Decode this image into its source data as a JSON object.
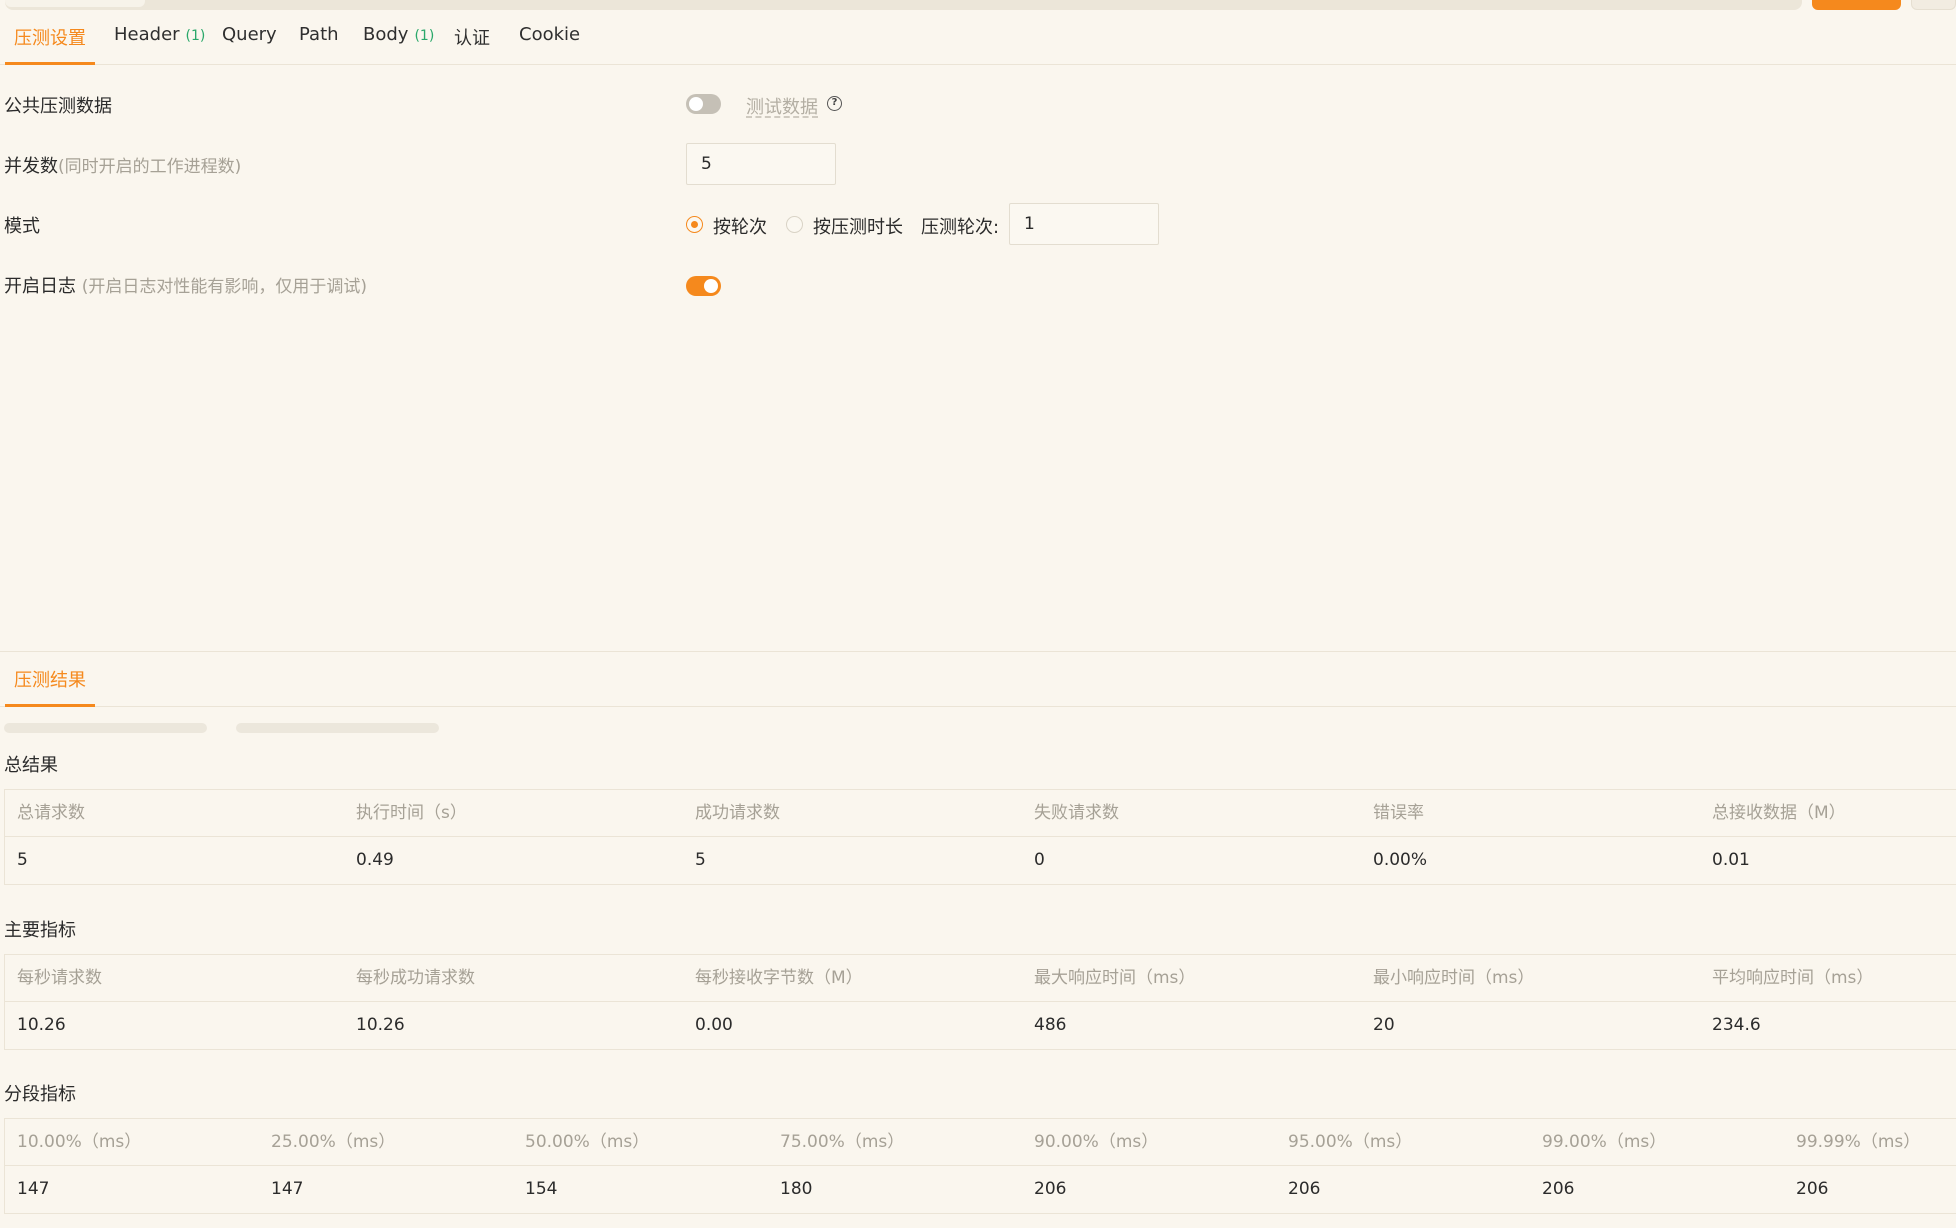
{
  "tabs": [
    {
      "label": "压测设置",
      "count": ""
    },
    {
      "label": "Header",
      "count": "(1)"
    },
    {
      "label": "Query",
      "count": ""
    },
    {
      "label": "Path",
      "count": ""
    },
    {
      "label": "Body",
      "count": "(1)"
    },
    {
      "label": "认证",
      "count": ""
    },
    {
      "label": "Cookie",
      "count": ""
    }
  ],
  "settings": {
    "public_data_label": "公共压测数据",
    "test_data_link": "测试数据",
    "public_data_enabled": false,
    "concurrency_label": "并发数",
    "concurrency_hint": "(同时开启的工作进程数)",
    "concurrency_value": "5",
    "mode_label": "模式",
    "mode_by_rounds": "按轮次",
    "mode_by_duration": "按压测时长",
    "rounds_label": "压测轮次:",
    "rounds_value": "1",
    "log_label": "开启日志",
    "log_hint": "(开启日志对性能有影响，仅用于调试)",
    "log_enabled": true
  },
  "results": {
    "tab_label": "压测结果",
    "summary_title": "总结果",
    "summary_headers": [
      "总请求数",
      "执行时间（s）",
      "成功请求数",
      "失败请求数",
      "错误率",
      "总接收数据（M）"
    ],
    "summary_values": [
      "5",
      "0.49",
      "5",
      "0",
      "0.00%",
      "0.01"
    ],
    "metrics_title": "主要指标",
    "metrics_headers": [
      "每秒请求数",
      "每秒成功请求数",
      "每秒接收字节数（M）",
      "最大响应时间（ms）",
      "最小响应时间（ms）",
      "平均响应时间（ms）"
    ],
    "metrics_values": [
      "10.26",
      "10.26",
      "0.00",
      "486",
      "20",
      "234.6"
    ],
    "percentiles_title": "分段指标",
    "percentiles_headers": [
      "10.00%（ms）",
      "25.00%（ms）",
      "50.00%（ms）",
      "75.00%（ms）",
      "90.00%（ms）",
      "95.00%（ms）",
      "99.00%（ms）",
      "99.99%（ms）"
    ],
    "percentiles_values": [
      "147",
      "147",
      "154",
      "180",
      "206",
      "206",
      "206",
      "206"
    ]
  },
  "colors": {
    "accent": "#f5891d",
    "count": "#2aa86a",
    "muted": "#a6a196",
    "background": "#faf6ee"
  }
}
